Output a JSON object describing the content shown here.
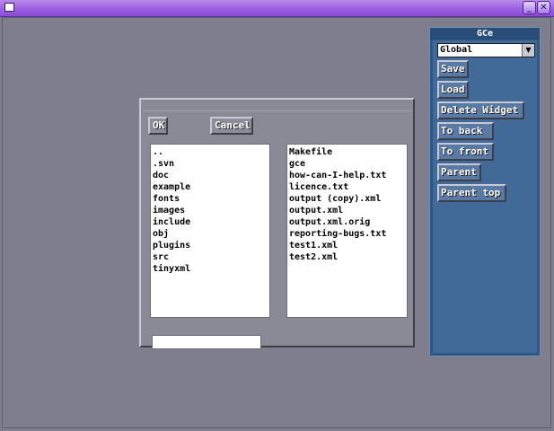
{
  "window": {
    "minimize_glyph": "_",
    "close_glyph": "✕"
  },
  "file_dialog": {
    "ok_label": "OK",
    "cancel_label": "Cancel",
    "directories": [
      "..",
      ".svn",
      "doc",
      "example",
      "fonts",
      "images",
      "include",
      "obj",
      "plugins",
      "src",
      "tinyxml"
    ],
    "files": [
      "Makefile",
      "gce",
      "how-can-I-help.txt",
      "licence.txt",
      "output (copy).xml",
      "output.xml",
      "output.xml.orig",
      "reporting-bugs.txt",
      "test1.xml",
      "test2.xml"
    ],
    "filename_value": ""
  },
  "gce_panel": {
    "title": "GCe",
    "scope_selected": "Global",
    "buttons": {
      "save": "Save",
      "load": "Load",
      "delete_widget": "Delete Widget",
      "to_back": "To back",
      "to_front": "To front",
      "parent": "Parent",
      "parent_top": "Parent top"
    }
  },
  "colors": {
    "title_bar": "#9b5fe0",
    "desktop": "#7e7e8c",
    "panel": "#2f5684"
  }
}
